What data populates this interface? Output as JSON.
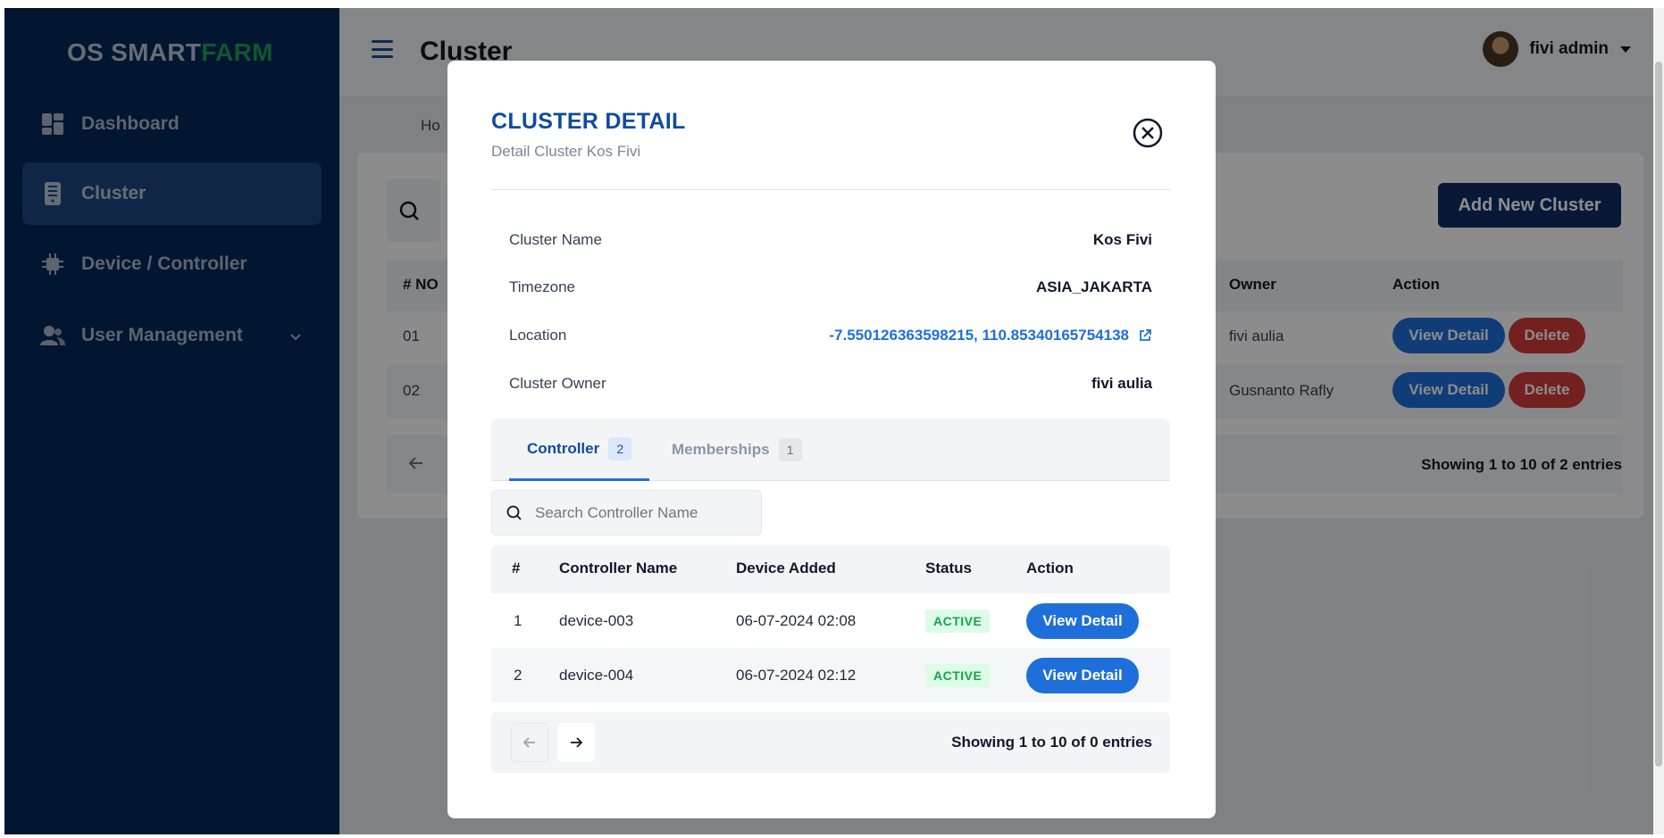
{
  "brand": {
    "part1": "OS SMART",
    "part2": "FARM"
  },
  "sidebar": {
    "items": [
      {
        "label": "Dashboard",
        "icon": "dashboard-icon"
      },
      {
        "label": "Cluster",
        "icon": "cluster-icon"
      },
      {
        "label": "Device / Controller",
        "icon": "chip-icon"
      },
      {
        "label": "User Management",
        "icon": "user-icon"
      }
    ]
  },
  "header": {
    "title": "Cluster",
    "user_name": "fivi admin"
  },
  "breadcrumb": "Ho",
  "background": {
    "add_button": "Add New Cluster",
    "columns": {
      "no": "# NO",
      "owner": "Owner",
      "action": "Action"
    },
    "rows": [
      {
        "no": "01",
        "owner": "fivi aulia",
        "view": "View Detail",
        "delete": "Delete"
      },
      {
        "no": "02",
        "owner": "Gusnanto Rafly",
        "view": "View Detail",
        "delete": "Delete"
      }
    ],
    "footer": "Showing 1 to 10 of 2 entries"
  },
  "modal": {
    "title": "CLUSTER DETAIL",
    "subtitle": "Detail Cluster Kos Fivi",
    "info": {
      "name_label": "Cluster Name",
      "name_value": "Kos Fivi",
      "tz_label": "Timezone",
      "tz_value": "ASIA_JAKARTA",
      "loc_label": "Location",
      "loc_value": "-7.550126363598215, 110.85340165754138",
      "owner_label": "Cluster Owner",
      "owner_value": "fivi aulia"
    },
    "tabs": [
      {
        "label": "Controller",
        "count": "2"
      },
      {
        "label": "Memberships",
        "count": "1"
      }
    ],
    "search_placeholder": "Search Controller Name",
    "columns": {
      "idx": "#",
      "name": "Controller Name",
      "added": "Device Added",
      "status": "Status",
      "action": "Action"
    },
    "rows": [
      {
        "idx": "1",
        "name": "device-003",
        "added": "06-07-2024 02:08",
        "status": "ACTIVE",
        "action": "View Detail"
      },
      {
        "idx": "2",
        "name": "device-004",
        "added": "06-07-2024 02:12",
        "status": "ACTIVE",
        "action": "View Detail"
      }
    ],
    "footer": "Showing 1 to 10 of 0 entries"
  },
  "colors": {
    "sidebar": "#04285a",
    "accent": "#1e6fd9",
    "brand_green": "#1f9d55",
    "danger": "#d23b3b",
    "active_status": "#16a34a"
  }
}
